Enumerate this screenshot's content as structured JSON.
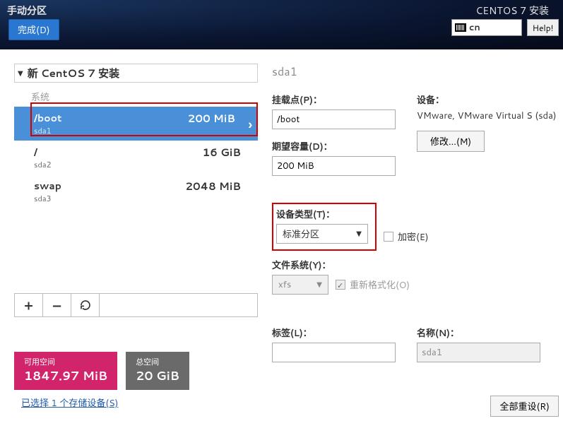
{
  "header": {
    "title_left": "手动分区",
    "done_btn": "完成(D)",
    "title_right": "CENTOS 7 安装",
    "lang_code": "cn",
    "help_btn": "Help!"
  },
  "accordion": {
    "title": "新 CentOS 7 安装",
    "system_label": "系统"
  },
  "partitions": [
    {
      "name": "/boot",
      "device": "sda1",
      "size": "200 MiB",
      "selected": true
    },
    {
      "name": "/",
      "device": "sda2",
      "size": "16 GiB",
      "selected": false
    },
    {
      "name": "swap",
      "device": "sda3",
      "size": "2048 MiB",
      "selected": false
    }
  ],
  "actions": {
    "add": "+",
    "remove": "−"
  },
  "right": {
    "title": "sda1",
    "mount_label": "挂载点(P)：",
    "mount_value": "/boot",
    "capacity_label": "期望容量(D)：",
    "capacity_value": "200 MiB",
    "device_label": "设备：",
    "device_info": "VMware, VMware Virtual S (sda)",
    "modify_btn": "修改...(M)",
    "device_type_label": "设备类型(T)：",
    "device_type_value": "标准分区",
    "encrypt_label": "加密(E)",
    "fs_label": "文件系统(Y)：",
    "fs_value": "xfs",
    "reformat_label": "重新格式化(O)",
    "tag_label": "标签(L)：",
    "tag_value": "",
    "name_label": "名称(N)：",
    "name_value": "sda1"
  },
  "bottom": {
    "avail_label": "可用空间",
    "avail_value": "1847.97 MiB",
    "total_label": "总空间",
    "total_value": "20 GiB",
    "storage_link": "已选择 1 个存储设备(S)",
    "reset_all": "全部重设(R)"
  }
}
